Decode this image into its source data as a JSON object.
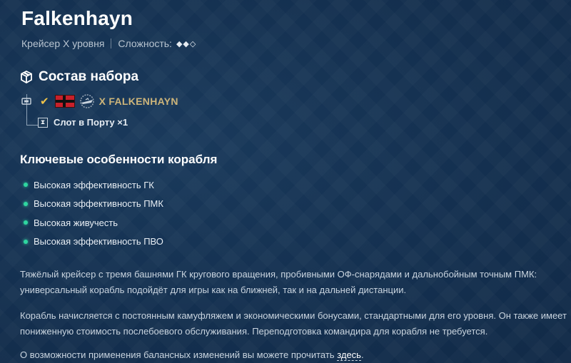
{
  "header": {
    "title": "Falkenhayn",
    "ship_class": "Крейсер X уровня",
    "difficulty_label": "Сложность:",
    "difficulty_marks": "◆◆◇",
    "difficulty_level": 2,
    "difficulty_max": 3
  },
  "bundle": {
    "heading": "Состав набора",
    "ship": {
      "check_icon": "check-icon",
      "nation": "Germany",
      "ship_name": "X FALKENHAYN"
    },
    "slot": {
      "label": "Слот в Порту ×1"
    }
  },
  "features": {
    "heading": "Ключевые особенности корабля",
    "items": [
      "Высокая эффективность ГК",
      "Высокая эффективность ПМК",
      "Высокая живучесть",
      "Высокая эффективность ПВО"
    ],
    "bullet_color": "#2fd6a0"
  },
  "description": {
    "p1_line1": "Тяжёлый крейсер с тремя башнями ГК кругового вращения, пробивными ОФ-снарядами и дальнобойным точным ПМК:",
    "p1_line2": "универсальный корабль подойдёт для игры как на ближней, так и на дальней дистанции.",
    "p2_line1": "Корабль начисляется с постоянным камуфляжем и экономическими бонусами, стандартными для его уровня. Он также имеет",
    "p2_line2": "пониженную стоимость послебоевого обслуживания. Переподготовка командира для корабля не требуется.",
    "p3_text": "О возможности применения балансных изменений вы можете прочитать",
    "p3_link": "здесь",
    "p3_end": "."
  },
  "colors": {
    "background": "#163352",
    "ship_name": "#cdb57a",
    "check": "#f0c44a"
  }
}
